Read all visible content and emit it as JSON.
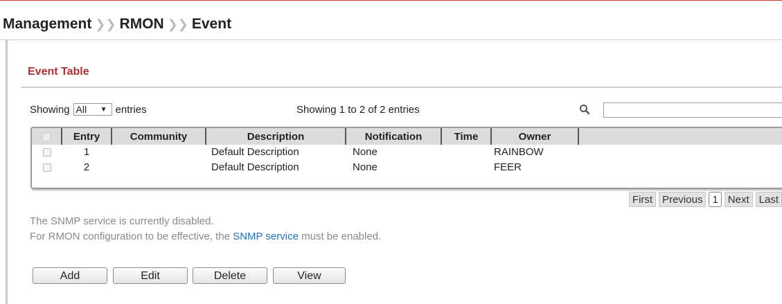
{
  "breadcrumb": [
    "Management",
    "RMON",
    "Event"
  ],
  "section_title": "Event Table",
  "showing": {
    "prefix": "Showing",
    "selected": "All",
    "suffix": "entries"
  },
  "summary": "Showing 1 to 2 of 2 entries",
  "search": {
    "placeholder": "",
    "value": ""
  },
  "table": {
    "columns": [
      "Entry",
      "Community",
      "Description",
      "Notification",
      "Time",
      "Owner"
    ],
    "rows": [
      {
        "entry": "1",
        "community": "",
        "description": "Default Description",
        "notification": "None",
        "time": "",
        "owner": "RAINBOW"
      },
      {
        "entry": "2",
        "community": "",
        "description": "Default Description",
        "notification": "None",
        "time": "",
        "owner": "FEER"
      }
    ]
  },
  "pager": {
    "first": "First",
    "previous": "Previous",
    "current": "1",
    "next": "Next",
    "last": "Last"
  },
  "notes": {
    "line1": "The SNMP service is currently disabled.",
    "line2_pre": "For RMON configuration to be effective, the ",
    "line2_link": "SNMP service",
    "line2_post": " must be enabled."
  },
  "buttons": {
    "add": "Add",
    "edit": "Edit",
    "delete": "Delete",
    "view": "View"
  },
  "colors": {
    "accent": "#b03030",
    "link": "#1a73c8",
    "note": "#8a8a8a"
  },
  "icons": {
    "search": "search-icon",
    "dropdown": "triangle-down-icon"
  }
}
